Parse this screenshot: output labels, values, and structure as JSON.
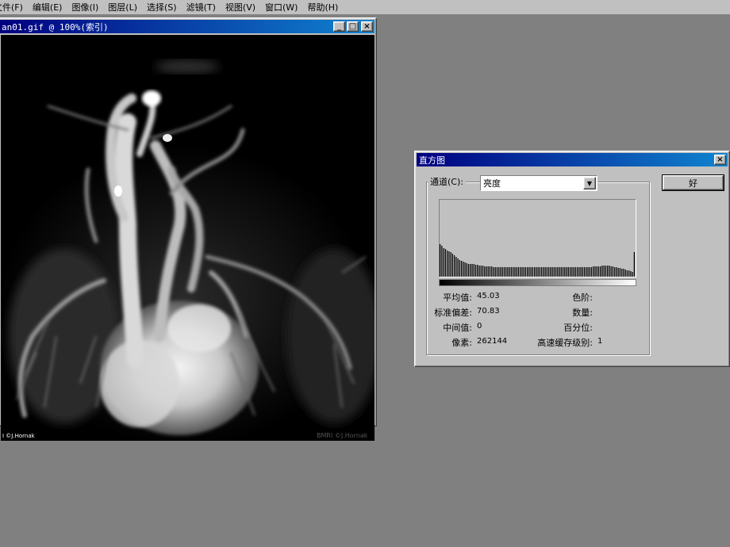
{
  "menu": [
    "文件(F)",
    "编辑(E)",
    "图像(I)",
    "图层(L)",
    "选择(S)",
    "滤镜(T)",
    "视图(V)",
    "窗口(W)",
    "帮助(H)"
  ],
  "image_window": {
    "title": "an01.gif @ 100%(索引)",
    "credit_left": "I ©J.Hornak",
    "credit_right": "BMRI ©J.Hornak",
    "buttons": {
      "minimize": "_",
      "maximize": "□",
      "close": "×"
    }
  },
  "histogram_dialog": {
    "title": "直方图",
    "close": "×",
    "channel_label": "通道(C):",
    "channel_value": "亮度",
    "ok_label": "好",
    "stats": {
      "mean_label": "平均值:",
      "mean": "45.03",
      "stddev_label": "标准偏差:",
      "stddev": "70.83",
      "median_label": "中间值:",
      "median": "0",
      "pixels_label": "像素:",
      "pixels": "262144",
      "level_label": "色阶:",
      "level": "",
      "count_label": "数量:",
      "count": "",
      "percentile_label": "百分位:",
      "percentile": "",
      "cache_label": "高速缓存级别:",
      "cache": "1"
    },
    "histogram_levels": [
      0.42,
      0.4,
      0.37,
      0.36,
      0.34,
      0.33,
      0.32,
      0.3,
      0.28,
      0.26,
      0.24,
      0.22,
      0.21,
      0.2,
      0.19,
      0.18,
      0.17,
      0.17,
      0.16,
      0.16,
      0.15,
      0.15,
      0.14,
      0.14,
      0.14,
      0.13,
      0.13,
      0.13,
      0.13,
      0.13,
      0.12,
      0.12,
      0.12,
      0.12,
      0.12,
      0.12,
      0.12,
      0.12,
      0.12,
      0.12,
      0.12,
      0.12,
      0.12,
      0.12,
      0.12,
      0.12,
      0.12,
      0.12,
      0.12,
      0.12,
      0.12,
      0.12,
      0.12,
      0.12,
      0.12,
      0.12,
      0.12,
      0.12,
      0.12,
      0.12,
      0.12,
      0.12,
      0.12,
      0.12,
      0.12,
      0.12,
      0.12,
      0.12,
      0.12,
      0.12,
      0.12,
      0.12,
      0.12,
      0.12,
      0.12,
      0.12,
      0.12,
      0.12,
      0.12,
      0.12,
      0.12,
      0.12,
      0.12,
      0.12,
      0.12,
      0.12,
      0.13,
      0.13,
      0.13,
      0.13,
      0.13,
      0.14,
      0.14,
      0.14,
      0.14,
      0.14,
      0.13,
      0.13,
      0.12,
      0.12,
      0.11,
      0.11,
      0.1,
      0.1,
      0.09,
      0.08,
      0.08,
      0.07,
      0.06,
      0.32
    ]
  }
}
